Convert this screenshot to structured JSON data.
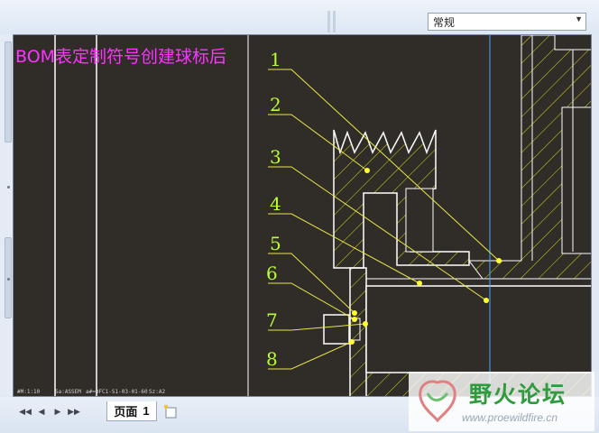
{
  "toolbar": {
    "style_value": "常规",
    "dropdown_icon": "chevron-down-icon"
  },
  "drawing": {
    "note_text": "BOM表定制符号创建球标后",
    "balloons": [
      "1",
      "2",
      "3",
      "4",
      "5",
      "6",
      "7",
      "8"
    ],
    "status": [
      "#M:1:10",
      "Sa:ASSEM",
      "a#=DFC1-S1-03-01-60",
      "Sz:A2"
    ]
  },
  "footer": {
    "page_label": "页面",
    "page_number": "1",
    "nav_icons": [
      "first-page-icon",
      "previous-page-icon",
      "next-page-icon",
      "last-page-icon"
    ],
    "add_page_icon": "new-page-icon"
  },
  "watermark": {
    "logo_text": "野火论坛",
    "url": "www.proewildfire.cn"
  },
  "colors": {
    "canvas_bg": "#302c28",
    "note": "#ff33ff",
    "balloon": "#b9ff33",
    "leader": "#e8e84a",
    "geometry": "#ffffff",
    "hatch": "#d8d820",
    "centerline": "#4da6ff"
  }
}
